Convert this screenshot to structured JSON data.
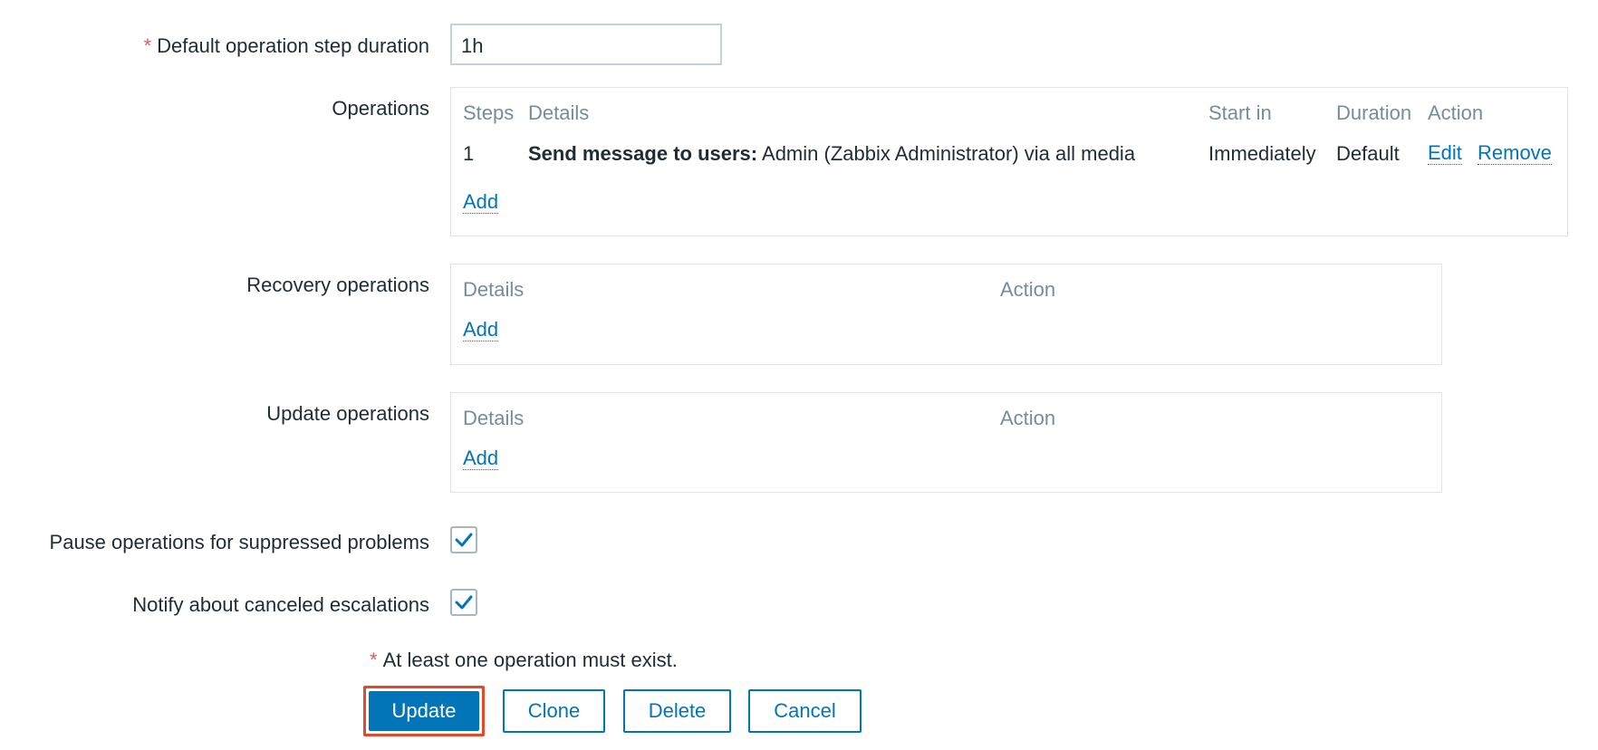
{
  "form": {
    "step_duration": {
      "required_mark": "*",
      "label": "Default operation step duration",
      "value": "1h"
    },
    "operations": {
      "label": "Operations",
      "headers": {
        "steps": "Steps",
        "details": "Details",
        "start_in": "Start in",
        "duration": "Duration",
        "action": "Action"
      },
      "rows": [
        {
          "steps": "1",
          "details_bold": "Send message to users:",
          "details_rest": "Admin (Zabbix Administrator) via all media",
          "start_in": "Immediately",
          "duration": "Default",
          "edit": "Edit",
          "remove": "Remove"
        }
      ],
      "add_label": "Add"
    },
    "recovery_operations": {
      "label": "Recovery operations",
      "headers": {
        "details": "Details",
        "action": "Action"
      },
      "add_label": "Add"
    },
    "update_operations": {
      "label": "Update operations",
      "headers": {
        "details": "Details",
        "action": "Action"
      },
      "add_label": "Add"
    },
    "pause_suppressed": {
      "label": "Pause operations for suppressed problems",
      "checked": true
    },
    "notify_canceled": {
      "label": "Notify about canceled escalations",
      "checked": true
    },
    "warning": {
      "required_mark": "*",
      "text": "At least one operation must exist."
    }
  },
  "buttons": {
    "update": "Update",
    "clone": "Clone",
    "delete": "Delete",
    "cancel": "Cancel"
  },
  "colors": {
    "link": "#0275b8",
    "required": "#e45959",
    "header_text": "#768d99",
    "highlight_outline": "#e8472c"
  }
}
